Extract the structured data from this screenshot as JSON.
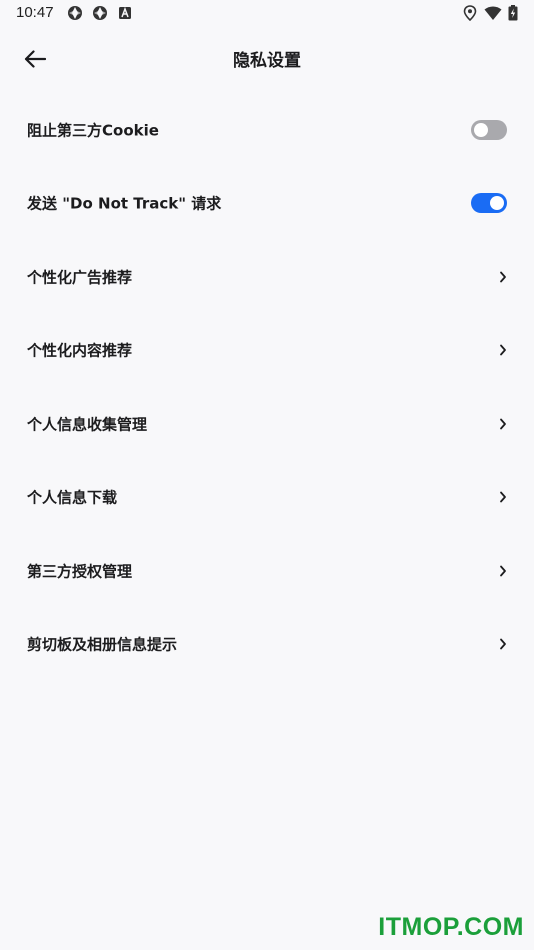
{
  "status_bar": {
    "time": "10:47",
    "left_icons": [
      "app-notification-icon",
      "app-notification-icon",
      "text-notification-icon"
    ],
    "right_icons": [
      "location-icon",
      "wifi-icon",
      "battery-charging-icon"
    ]
  },
  "header": {
    "title": "隐私设置",
    "back_icon": "back-arrow-icon"
  },
  "settings": {
    "items": [
      {
        "label": "阻止第三方Cookie",
        "control": "toggle",
        "enabled": false
      },
      {
        "label": "发送 \"Do Not Track\" 请求",
        "control": "toggle",
        "enabled": true
      },
      {
        "label": "个性化广告推荐",
        "control": "chevron"
      },
      {
        "label": "个性化内容推荐",
        "control": "chevron"
      },
      {
        "label": "个人信息收集管理",
        "control": "chevron"
      },
      {
        "label": "个人信息下载",
        "control": "chevron"
      },
      {
        "label": "第三方授权管理",
        "control": "chevron"
      },
      {
        "label": "剪切板及相册信息提示",
        "control": "chevron"
      }
    ]
  },
  "colors": {
    "background": "#f8f8fa",
    "toggle_on": "#1a6cf4",
    "toggle_off": "#a9a9ad",
    "watermark": "#1b9f3a"
  },
  "watermark": "ITMOP.COM"
}
